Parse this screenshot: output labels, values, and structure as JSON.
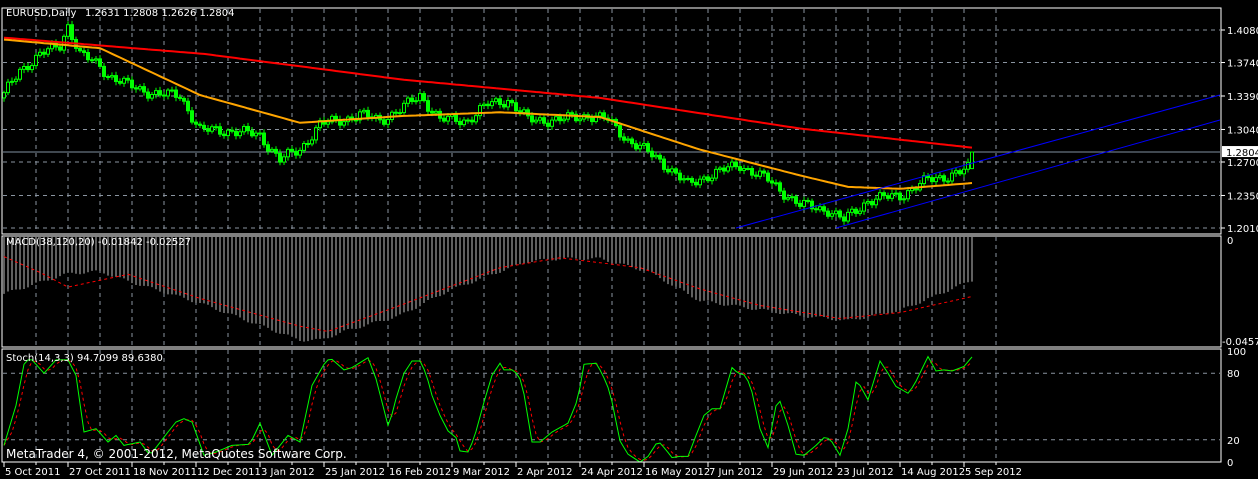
{
  "header": {
    "symbol": "EURUSD,Daily",
    "ohlc": "1.2631 1.2808 1.2626 1.2804"
  },
  "footer": {
    "copyright": "MetaTrader 4, © 2001-2012, MetaQuotes Software Corp."
  },
  "colors": {
    "background": "#000000",
    "candle": "#00ff00",
    "ma_slow": "#ff0000",
    "ma_fast": "#ffa500",
    "trendline": "#0000ff",
    "macd_hist": "#c0c0c0",
    "macd_signal": "#ff0000",
    "stoch_main": "#00ff00",
    "stoch_signal": "#ff0000",
    "grid": "#8a94a0"
  },
  "chart_data": [
    {
      "type": "candlestick",
      "title": "EURUSD,Daily",
      "price_ticks": [
        "1.4080",
        "1.3740",
        "1.3390",
        "1.3040",
        "1.2700",
        "1.2350",
        "1.2010"
      ],
      "price_ticks_values": [
        1.408,
        1.374,
        1.339,
        1.304,
        1.27,
        1.235,
        1.201
      ],
      "ylim": [
        1.201,
        1.408
      ],
      "current_price": "1.2804",
      "last_bar": {
        "open": 1.2631,
        "high": 1.2808,
        "low": 1.2626,
        "close": 1.2804
      },
      "bars": 243,
      "x_labels": [
        "5 Oct 2011",
        "27 Oct 2011",
        "18 Nov 2011",
        "12 Dec 2011",
        "3 Jan 2012",
        "25 Jan 2012",
        "16 Feb 2012",
        "9 Mar 2012",
        "2 Apr 2012",
        "24 Apr 2012",
        "16 May 2012",
        "7 Jun 2012",
        "29 Jun 2012",
        "23 Jul 2012",
        "14 Aug 2012",
        "5 Sep 2012"
      ],
      "x_label_every_bars": 16,
      "close_keypoints": [
        [
          0,
          1.34
        ],
        [
          4,
          1.366
        ],
        [
          9,
          1.382
        ],
        [
          14,
          1.392
        ],
        [
          16,
          1.413
        ],
        [
          19,
          1.382
        ],
        [
          24,
          1.371
        ],
        [
          26,
          1.361
        ],
        [
          31,
          1.35
        ],
        [
          39,
          1.34
        ],
        [
          44,
          1.34
        ],
        [
          49,
          1.303
        ],
        [
          56,
          1.303
        ],
        [
          64,
          1.298
        ],
        [
          69,
          1.272
        ],
        [
          74,
          1.283
        ],
        [
          79,
          1.309
        ],
        [
          89,
          1.319
        ],
        [
          94,
          1.314
        ],
        [
          99,
          1.324
        ],
        [
          104,
          1.34
        ],
        [
          109,
          1.314
        ],
        [
          116,
          1.314
        ],
        [
          121,
          1.33
        ],
        [
          126,
          1.335
        ],
        [
          131,
          1.314
        ],
        [
          139,
          1.314
        ],
        [
          146,
          1.319
        ],
        [
          151,
          1.314
        ],
        [
          156,
          1.293
        ],
        [
          164,
          1.272
        ],
        [
          171,
          1.246
        ],
        [
          176,
          1.256
        ],
        [
          184,
          1.267
        ],
        [
          191,
          1.251
        ],
        [
          199,
          1.225
        ],
        [
          206,
          1.22
        ],
        [
          210,
          1.209
        ],
        [
          216,
          1.23
        ],
        [
          224,
          1.235
        ],
        [
          231,
          1.251
        ],
        [
          239,
          1.259
        ],
        [
          241,
          1.2631
        ],
        [
          242,
          1.2804
        ]
      ],
      "ma_slow_keypoints": [
        [
          0,
          1.4
        ],
        [
          50,
          1.383
        ],
        [
          100,
          1.356
        ],
        [
          149,
          1.337
        ],
        [
          199,
          1.305
        ],
        [
          242,
          1.285
        ]
      ],
      "ma_fast_keypoints": [
        [
          0,
          1.398
        ],
        [
          24,
          1.389
        ],
        [
          49,
          1.34
        ],
        [
          74,
          1.311
        ],
        [
          99,
          1.318
        ],
        [
          124,
          1.322
        ],
        [
          149,
          1.317
        ],
        [
          174,
          1.283
        ],
        [
          199,
          1.256
        ],
        [
          211,
          1.244
        ],
        [
          224,
          1.242
        ],
        [
          242,
          1.248
        ]
      ],
      "trendlines": [
        [
          [
            183,
            1.201
          ],
          [
            304,
            1.34
          ]
        ],
        [
          [
            208,
            1.201
          ],
          [
            304,
            1.3139
          ]
        ]
      ]
    },
    {
      "type": "bar+line",
      "title": "MACD(38,120,20) -0.01842 -0.02527",
      "y_ticks": [
        "0",
        "-0.04574"
      ],
      "ylim": [
        -0.04574,
        0
      ],
      "histogram_keypoints": [
        [
          0,
          -0.0241
        ],
        [
          16,
          -0.0155
        ],
        [
          24,
          -0.0146
        ],
        [
          31,
          -0.0187
        ],
        [
          49,
          -0.028
        ],
        [
          74,
          -0.0437
        ],
        [
          79,
          -0.0437
        ],
        [
          86,
          -0.0395
        ],
        [
          99,
          -0.0333
        ],
        [
          111,
          -0.0229
        ],
        [
          124,
          -0.0146
        ],
        [
          131,
          -0.0104
        ],
        [
          139,
          -0.0092
        ],
        [
          149,
          -0.0092
        ],
        [
          161,
          -0.0146
        ],
        [
          174,
          -0.027
        ],
        [
          199,
          -0.0333
        ],
        [
          211,
          -0.0354
        ],
        [
          224,
          -0.0312
        ],
        [
          242,
          -0.0184
        ]
      ],
      "signal_keypoints": [
        [
          0,
          -0.0083
        ],
        [
          9,
          -0.015
        ],
        [
          16,
          -0.0212
        ],
        [
          31,
          -0.0158
        ],
        [
          49,
          -0.026
        ],
        [
          74,
          -0.0378
        ],
        [
          81,
          -0.04
        ],
        [
          99,
          -0.029
        ],
        [
          124,
          -0.013
        ],
        [
          139,
          -0.0088
        ],
        [
          159,
          -0.013
        ],
        [
          174,
          -0.022
        ],
        [
          189,
          -0.029
        ],
        [
          209,
          -0.0345
        ],
        [
          224,
          -0.032
        ],
        [
          242,
          -0.0252
        ]
      ]
    },
    {
      "type": "line",
      "title": "Stoch(14,3,3) 94.7099 89.6380",
      "y_ticks": [
        "100",
        "80",
        "20",
        "0"
      ],
      "ylim": [
        0,
        100
      ],
      "main_keypoints": [
        [
          0,
          15
        ],
        [
          1.5,
          33
        ],
        [
          3,
          51
        ],
        [
          5,
          88
        ],
        [
          6.5,
          94
        ],
        [
          10,
          80
        ],
        [
          13,
          92
        ],
        [
          16,
          92
        ],
        [
          18,
          78
        ],
        [
          20,
          27
        ],
        [
          23,
          30
        ],
        [
          26,
          18
        ],
        [
          28,
          24
        ],
        [
          30,
          15
        ],
        [
          34,
          18
        ],
        [
          36.5,
          6
        ],
        [
          41,
          27
        ],
        [
          43,
          36
        ],
        [
          45,
          39
        ],
        [
          47,
          36
        ],
        [
          50,
          6
        ],
        [
          53,
          9
        ],
        [
          57,
          15
        ],
        [
          61.5,
          16
        ],
        [
          64,
          35
        ],
        [
          67,
          6
        ],
        [
          71,
          24
        ],
        [
          74,
          18
        ],
        [
          77,
          69
        ],
        [
          80,
          88
        ],
        [
          81.5,
          94
        ],
        [
          85,
          83
        ],
        [
          87,
          85
        ],
        [
          91,
          94
        ],
        [
          93,
          75
        ],
        [
          96,
          33
        ],
        [
          96.5,
          36
        ],
        [
          98,
          57
        ],
        [
          100,
          80
        ],
        [
          102,
          91
        ],
        [
          104,
          91
        ],
        [
          105.5,
          80
        ],
        [
          107,
          60
        ],
        [
          109,
          42
        ],
        [
          111,
          28
        ],
        [
          113,
          22
        ],
        [
          114,
          10
        ],
        [
          116,
          9
        ],
        [
          117.5,
          21
        ],
        [
          120,
          54
        ],
        [
          122,
          78
        ],
        [
          124,
          89
        ],
        [
          125,
          83
        ],
        [
          127.5,
          83
        ],
        [
          129.5,
          72
        ],
        [
          132,
          18
        ],
        [
          134,
          18
        ],
        [
          137,
          27
        ],
        [
          138.5,
          30
        ],
        [
          141,
          35
        ],
        [
          143.5,
          57
        ],
        [
          145,
          88
        ],
        [
          148,
          89
        ],
        [
          149.5,
          80
        ],
        [
          151.5,
          63
        ],
        [
          154,
          19
        ],
        [
          156,
          7
        ],
        [
          159,
          0
        ],
        [
          161,
          5
        ],
        [
          163.5,
          19
        ],
        [
          165.5,
          11
        ],
        [
          167,
          4
        ],
        [
          169,
          5
        ],
        [
          171,
          5
        ],
        [
          173,
          24
        ],
        [
          175,
          42
        ],
        [
          177,
          48
        ],
        [
          179,
          48
        ],
        [
          182,
          85
        ],
        [
          183.5,
          80
        ],
        [
          185.5,
          78
        ],
        [
          187,
          63
        ],
        [
          189,
          30
        ],
        [
          191,
          13
        ],
        [
          193.5,
          60
        ],
        [
          196,
          33
        ],
        [
          198,
          7
        ],
        [
          200,
          6
        ],
        [
          203,
          15
        ],
        [
          205,
          22
        ],
        [
          206.5,
          21
        ],
        [
          209,
          6
        ],
        [
          211,
          30
        ],
        [
          213,
          72
        ],
        [
          214,
          69
        ],
        [
          216,
          56
        ],
        [
          219,
          91
        ],
        [
          221,
          80
        ],
        [
          223,
          68
        ],
        [
          226,
          62
        ],
        [
          227.5,
          69
        ],
        [
          231,
          95
        ],
        [
          233,
          82
        ],
        [
          235,
          83
        ],
        [
          237,
          82
        ],
        [
          240,
          86
        ],
        [
          242,
          94.71
        ]
      ],
      "signal_last": 89.638
    }
  ]
}
